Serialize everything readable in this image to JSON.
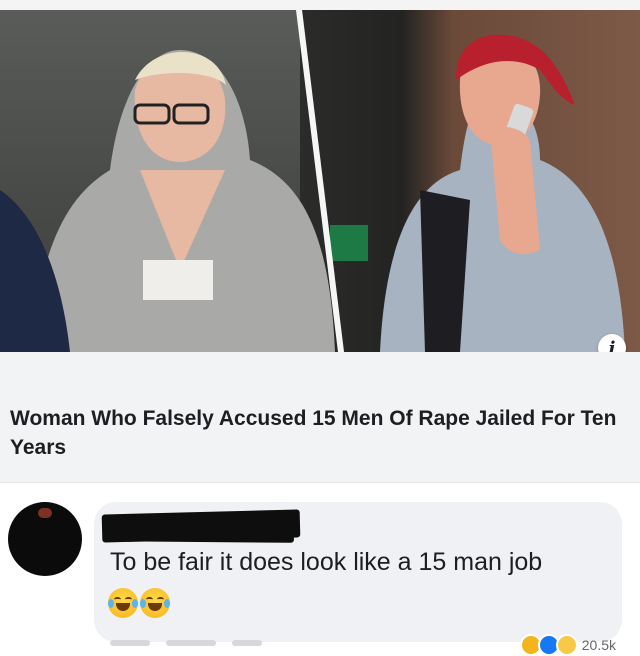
{
  "post": {
    "info_badge": "i",
    "headline": "Woman Who Falsely Accused 15 Men Of Rape Jailed For Ten Years"
  },
  "comment": {
    "text": "To be fair it does look like a 15 man job",
    "emojis": [
      "laughing-tears-emoji",
      "laughing-tears-emoji"
    ],
    "reaction_count": "20.5k"
  },
  "colors": {
    "caption_bg": "#f2f3f5",
    "bubble_bg": "#eff1f4",
    "text": "#1c1e21",
    "like_blue": "#1877f2"
  }
}
